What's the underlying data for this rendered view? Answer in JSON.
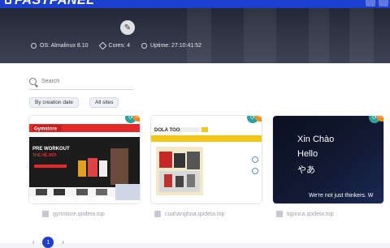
{
  "app": {
    "logo_text": "FASTPANEL"
  },
  "server": {
    "os": "OS: Almalinux 8.10",
    "cores": "Cores: 4",
    "uptime": "Uptime: 27:10:41:52"
  },
  "search": {
    "placeholder": "Search"
  },
  "filters": {
    "sort": "By creation date",
    "scope": "All sites"
  },
  "sites": [
    {
      "name": "gymstore.qodeta.top"
    },
    {
      "name": "cuahanghoa.qodeta.top"
    },
    {
      "name": "tigonca.qodeta.top"
    }
  ],
  "thumb3": {
    "line1": "Xin Chào",
    "line2": "Hello",
    "line3": "やあ",
    "tagline": "We're not just thinkers. W"
  },
  "thumb1": {
    "brand": "Gymstore",
    "headline": "PRE WORKOUT",
    "sub": "THẾ HỆ MỚI"
  },
  "thumb2": {
    "brand": "DOLA TOOL"
  },
  "pager": {
    "current": "1"
  },
  "colors": {
    "accent": "#1d3fd0",
    "teal": "#2aa199",
    "orange": "#f28c1b"
  }
}
